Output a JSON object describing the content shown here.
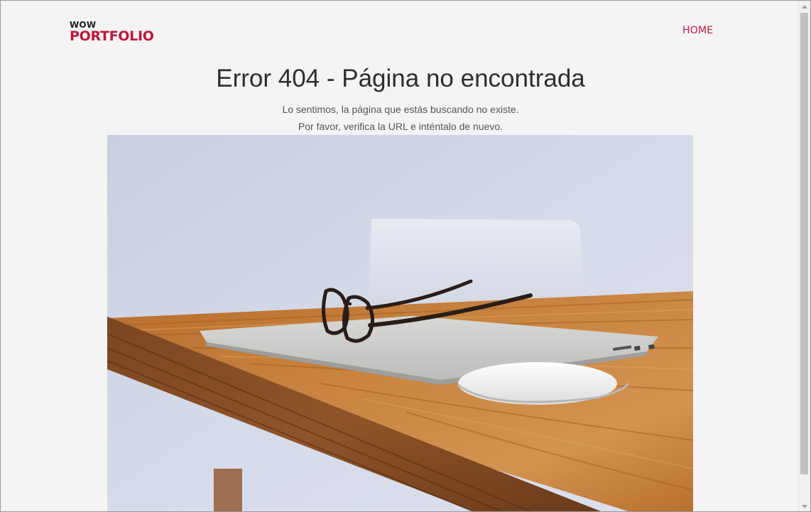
{
  "header": {
    "logo_top": "WOW",
    "logo_bottom": "PORTFOLIO",
    "nav_home": "HOME"
  },
  "main": {
    "title": "Error 404 - Página no encontrada",
    "message_line1": "Lo sentimos, la página que estás buscando no existe.",
    "message_line2": "Por favor, verifica la URL e inténtalo de nuevo."
  },
  "colors": {
    "brand": "#c0163b",
    "background": "#f4f4f4",
    "heading": "#2e2e2e",
    "body_text": "#555555"
  },
  "icons": [
    "scroll-up-arrow-icon",
    "scroll-down-arrow-icon"
  ]
}
